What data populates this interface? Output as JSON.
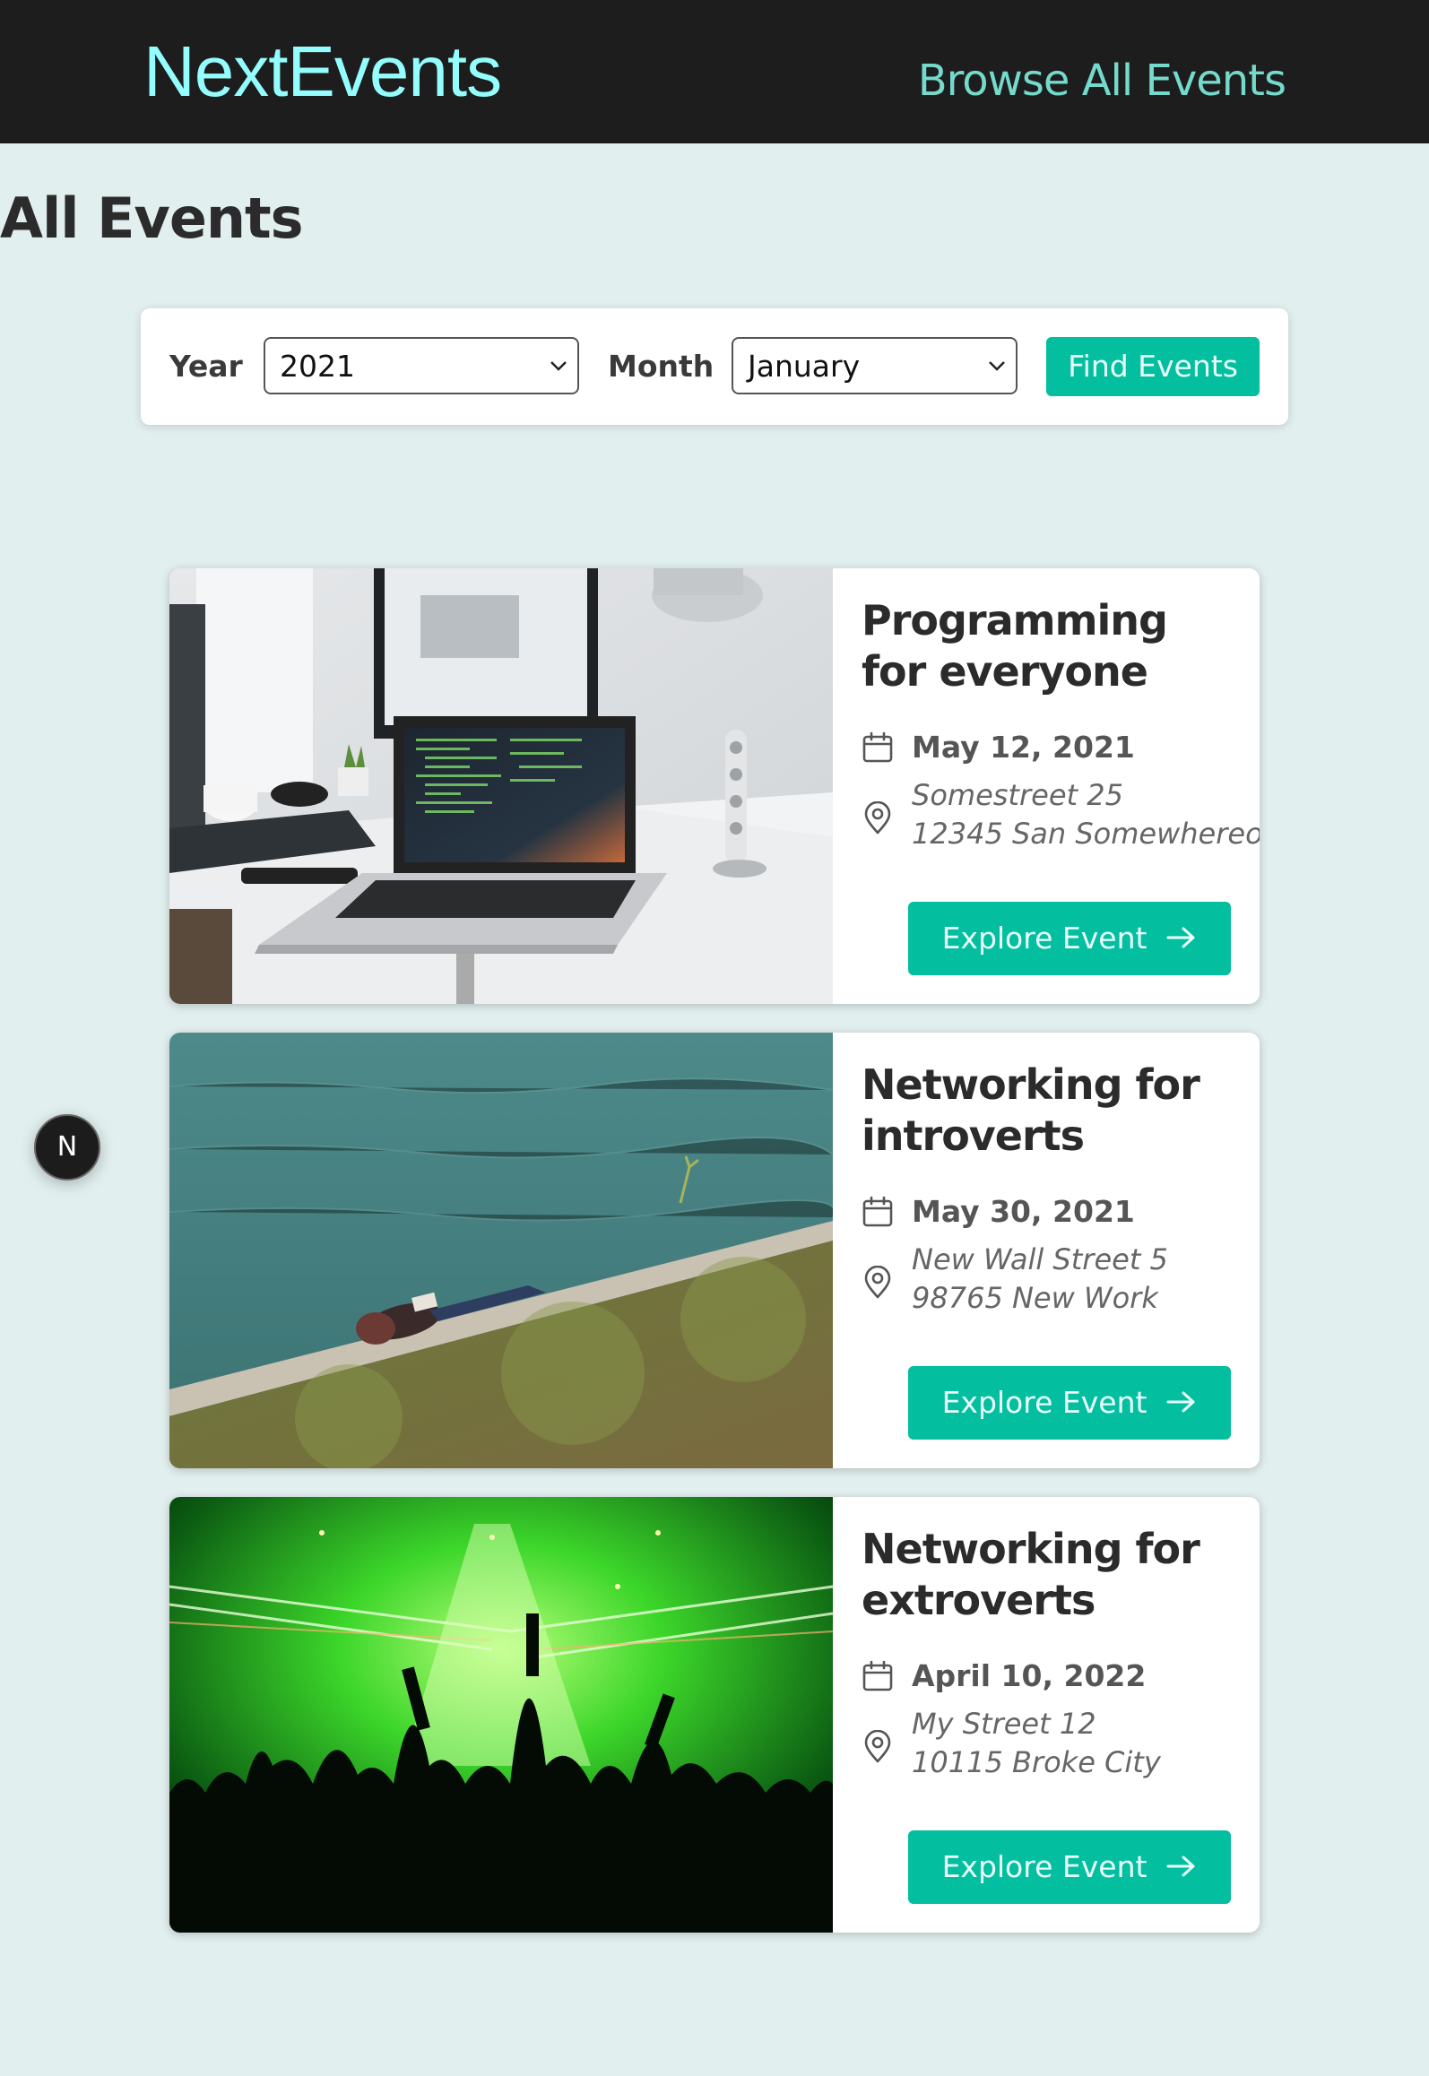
{
  "header": {
    "logo": "NextEvents",
    "nav_link": "Browse All Events"
  },
  "page": {
    "title": "All Events"
  },
  "filter": {
    "year_label": "Year",
    "year_value": "2021",
    "month_label": "Month",
    "month_value": "January",
    "submit_label": "Find Events"
  },
  "events": [
    {
      "title": "Programming for everyone",
      "date": "May 12, 2021",
      "address_line1": "Somestreet 25",
      "address_line2": "12345 San Somewhereo",
      "cta": "Explore Event",
      "image": "laptop-on-desk"
    },
    {
      "title": "Networking for introverts",
      "date": "May 30, 2021",
      "address_line1": "New Wall Street 5",
      "address_line2": "98765 New Work",
      "cta": "Explore Event",
      "image": "person-lying-by-water"
    },
    {
      "title": "Networking for extroverts",
      "date": "April 10, 2022",
      "address_line1": "My Street 12",
      "address_line2": "10115 Broke City",
      "cta": "Explore Event",
      "image": "concert-green-lasers"
    }
  ],
  "dev_indicator": {
    "label": "N"
  },
  "colors": {
    "header_bg": "#1d1d1d",
    "logo": "#94fdfd",
    "nav_link": "#74dacc",
    "page_bg": "#e2efef",
    "accent": "#03be9f"
  },
  "icons": {
    "date": "calendar-icon",
    "address": "location-pin-icon",
    "cta": "arrow-right-icon",
    "select": "chevron-down-icon"
  }
}
